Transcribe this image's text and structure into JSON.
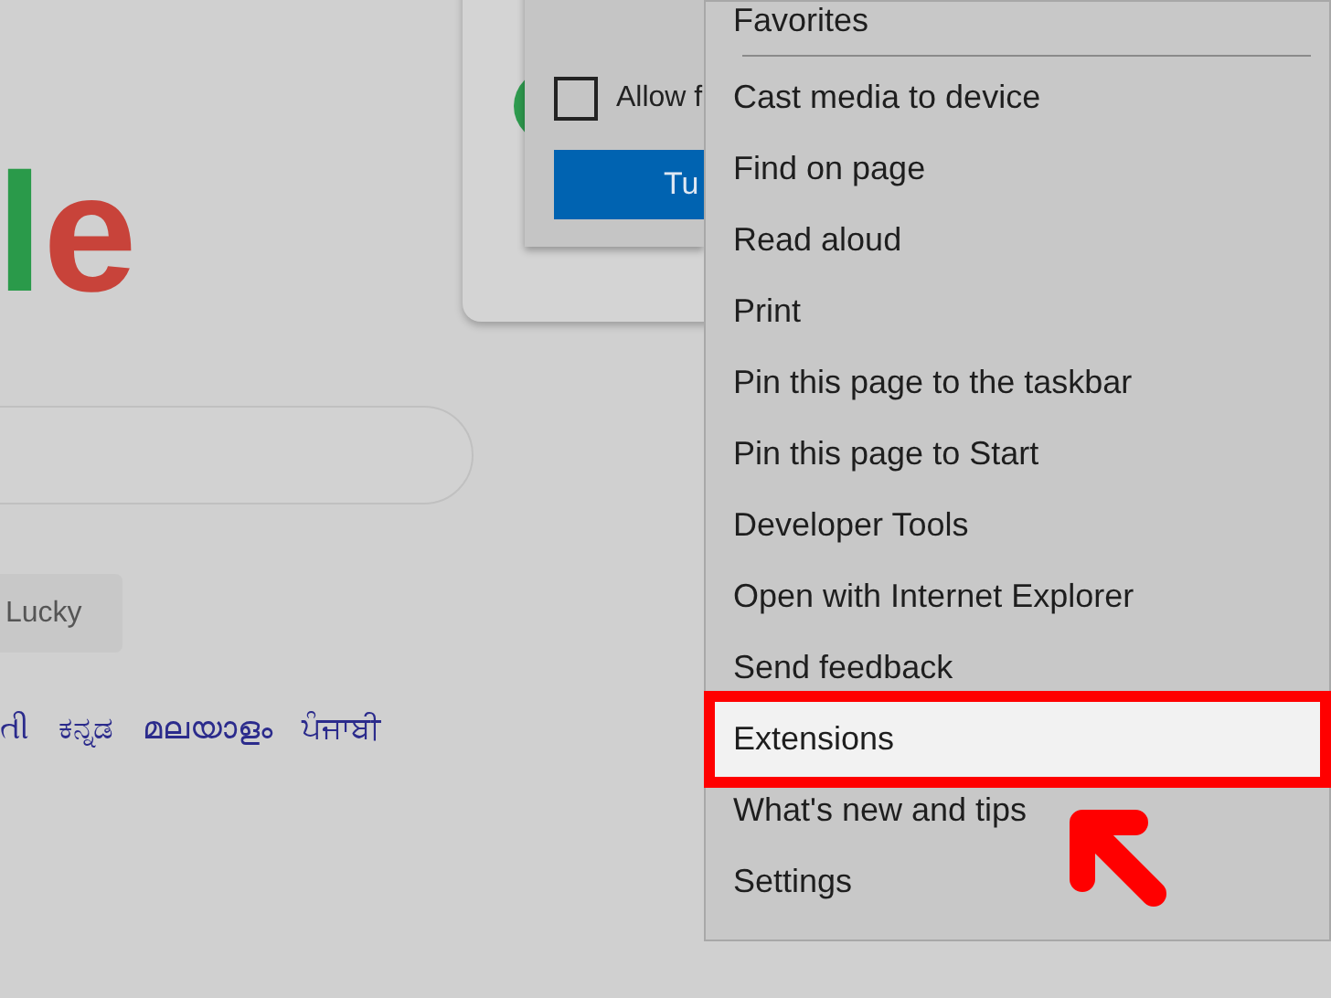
{
  "page": {
    "logo": [
      {
        "letter": "l",
        "color": "#2a9a4a"
      },
      {
        "letter": "e",
        "color": "#c8433a"
      }
    ],
    "lucky_button": "Lucky",
    "languages": [
      "તી",
      "ಕನ್ನಡ",
      "മലയാളം",
      "ਪੰਜਾਬੀ"
    ]
  },
  "dialog": {
    "checkbox": {
      "label": "Allow f",
      "checked": false
    },
    "button": "Tu"
  },
  "menu": {
    "items": [
      {
        "label": "Favorites",
        "selected": false,
        "divider_after": true
      },
      {
        "label": "Cast media to device",
        "selected": false,
        "divider_after": false
      },
      {
        "label": "Find on page",
        "selected": false,
        "divider_after": false
      },
      {
        "label": "Read aloud",
        "selected": false,
        "divider_after": false
      },
      {
        "label": "Print",
        "selected": false,
        "divider_after": false
      },
      {
        "label": "Pin this page to the taskbar",
        "selected": false,
        "divider_after": false
      },
      {
        "label": "Pin this page to Start",
        "selected": false,
        "divider_after": false
      },
      {
        "label": "Developer Tools",
        "selected": false,
        "divider_after": false
      },
      {
        "label": "Open with Internet Explorer",
        "selected": false,
        "divider_after": false
      },
      {
        "label": "Send feedback",
        "selected": false,
        "divider_after": false
      },
      {
        "label": "Extensions",
        "selected": true,
        "divider_after": false
      },
      {
        "label": "What's new and tips",
        "selected": false,
        "divider_after": false
      },
      {
        "label": "Settings",
        "selected": false,
        "divider_after": false
      }
    ]
  }
}
